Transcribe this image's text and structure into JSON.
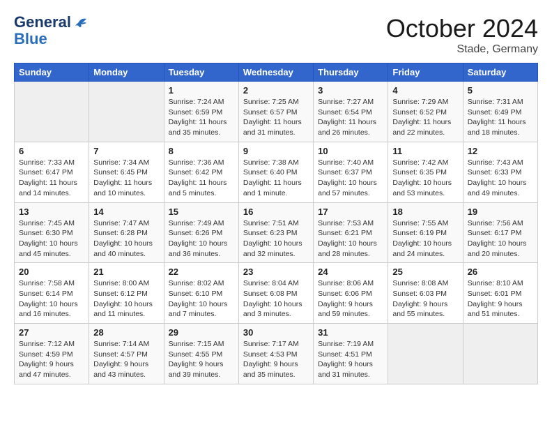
{
  "header": {
    "logo_general": "General",
    "logo_blue": "Blue",
    "month": "October 2024",
    "location": "Stade, Germany"
  },
  "days_of_week": [
    "Sunday",
    "Monday",
    "Tuesday",
    "Wednesday",
    "Thursday",
    "Friday",
    "Saturday"
  ],
  "weeks": [
    [
      {
        "day": "",
        "info": ""
      },
      {
        "day": "",
        "info": ""
      },
      {
        "day": "1",
        "info": "Sunrise: 7:24 AM\nSunset: 6:59 PM\nDaylight: 11 hours and 35 minutes."
      },
      {
        "day": "2",
        "info": "Sunrise: 7:25 AM\nSunset: 6:57 PM\nDaylight: 11 hours and 31 minutes."
      },
      {
        "day": "3",
        "info": "Sunrise: 7:27 AM\nSunset: 6:54 PM\nDaylight: 11 hours and 26 minutes."
      },
      {
        "day": "4",
        "info": "Sunrise: 7:29 AM\nSunset: 6:52 PM\nDaylight: 11 hours and 22 minutes."
      },
      {
        "day": "5",
        "info": "Sunrise: 7:31 AM\nSunset: 6:49 PM\nDaylight: 11 hours and 18 minutes."
      }
    ],
    [
      {
        "day": "6",
        "info": "Sunrise: 7:33 AM\nSunset: 6:47 PM\nDaylight: 11 hours and 14 minutes."
      },
      {
        "day": "7",
        "info": "Sunrise: 7:34 AM\nSunset: 6:45 PM\nDaylight: 11 hours and 10 minutes."
      },
      {
        "day": "8",
        "info": "Sunrise: 7:36 AM\nSunset: 6:42 PM\nDaylight: 11 hours and 5 minutes."
      },
      {
        "day": "9",
        "info": "Sunrise: 7:38 AM\nSunset: 6:40 PM\nDaylight: 11 hours and 1 minute."
      },
      {
        "day": "10",
        "info": "Sunrise: 7:40 AM\nSunset: 6:37 PM\nDaylight: 10 hours and 57 minutes."
      },
      {
        "day": "11",
        "info": "Sunrise: 7:42 AM\nSunset: 6:35 PM\nDaylight: 10 hours and 53 minutes."
      },
      {
        "day": "12",
        "info": "Sunrise: 7:43 AM\nSunset: 6:33 PM\nDaylight: 10 hours and 49 minutes."
      }
    ],
    [
      {
        "day": "13",
        "info": "Sunrise: 7:45 AM\nSunset: 6:30 PM\nDaylight: 10 hours and 45 minutes."
      },
      {
        "day": "14",
        "info": "Sunrise: 7:47 AM\nSunset: 6:28 PM\nDaylight: 10 hours and 40 minutes."
      },
      {
        "day": "15",
        "info": "Sunrise: 7:49 AM\nSunset: 6:26 PM\nDaylight: 10 hours and 36 minutes."
      },
      {
        "day": "16",
        "info": "Sunrise: 7:51 AM\nSunset: 6:23 PM\nDaylight: 10 hours and 32 minutes."
      },
      {
        "day": "17",
        "info": "Sunrise: 7:53 AM\nSunset: 6:21 PM\nDaylight: 10 hours and 28 minutes."
      },
      {
        "day": "18",
        "info": "Sunrise: 7:55 AM\nSunset: 6:19 PM\nDaylight: 10 hours and 24 minutes."
      },
      {
        "day": "19",
        "info": "Sunrise: 7:56 AM\nSunset: 6:17 PM\nDaylight: 10 hours and 20 minutes."
      }
    ],
    [
      {
        "day": "20",
        "info": "Sunrise: 7:58 AM\nSunset: 6:14 PM\nDaylight: 10 hours and 16 minutes."
      },
      {
        "day": "21",
        "info": "Sunrise: 8:00 AM\nSunset: 6:12 PM\nDaylight: 10 hours and 11 minutes."
      },
      {
        "day": "22",
        "info": "Sunrise: 8:02 AM\nSunset: 6:10 PM\nDaylight: 10 hours and 7 minutes."
      },
      {
        "day": "23",
        "info": "Sunrise: 8:04 AM\nSunset: 6:08 PM\nDaylight: 10 hours and 3 minutes."
      },
      {
        "day": "24",
        "info": "Sunrise: 8:06 AM\nSunset: 6:06 PM\nDaylight: 9 hours and 59 minutes."
      },
      {
        "day": "25",
        "info": "Sunrise: 8:08 AM\nSunset: 6:03 PM\nDaylight: 9 hours and 55 minutes."
      },
      {
        "day": "26",
        "info": "Sunrise: 8:10 AM\nSunset: 6:01 PM\nDaylight: 9 hours and 51 minutes."
      }
    ],
    [
      {
        "day": "27",
        "info": "Sunrise: 7:12 AM\nSunset: 4:59 PM\nDaylight: 9 hours and 47 minutes."
      },
      {
        "day": "28",
        "info": "Sunrise: 7:14 AM\nSunset: 4:57 PM\nDaylight: 9 hours and 43 minutes."
      },
      {
        "day": "29",
        "info": "Sunrise: 7:15 AM\nSunset: 4:55 PM\nDaylight: 9 hours and 39 minutes."
      },
      {
        "day": "30",
        "info": "Sunrise: 7:17 AM\nSunset: 4:53 PM\nDaylight: 9 hours and 35 minutes."
      },
      {
        "day": "31",
        "info": "Sunrise: 7:19 AM\nSunset: 4:51 PM\nDaylight: 9 hours and 31 minutes."
      },
      {
        "day": "",
        "info": ""
      },
      {
        "day": "",
        "info": ""
      }
    ]
  ]
}
